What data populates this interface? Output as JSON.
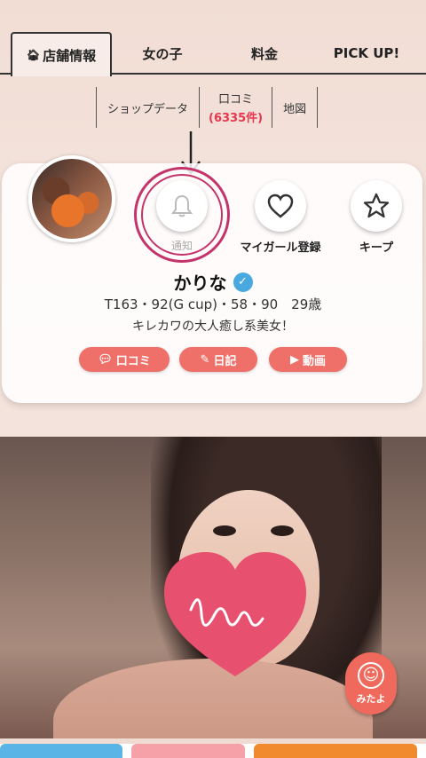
{
  "tabs": [
    {
      "label": "店舗情報",
      "active": true
    },
    {
      "label": "女の子"
    },
    {
      "label": "料金"
    },
    {
      "label": "PICK UP!"
    }
  ],
  "subtabs": {
    "shop_data": "ショップデータ",
    "reviews": "口コミ",
    "reviews_count": "(6335件)",
    "map": "地図"
  },
  "actions": {
    "notify": "通知",
    "my_girl": "マイガール登録",
    "keep": "キープ"
  },
  "profile": {
    "name": "かりな",
    "stats": "T163・92(G cup)・58・90　29歳",
    "catchphrase": "キレカワの大人癒し系美女！"
  },
  "buttons": {
    "review": "口コミ",
    "diary": "日記",
    "video": "動画"
  },
  "floating": {
    "label": "みたよ"
  },
  "colors": {
    "accent": "#ef7069",
    "highlight_ring": "#c4336a",
    "review_count": "#e8364e",
    "verified": "#4aa8e0"
  }
}
